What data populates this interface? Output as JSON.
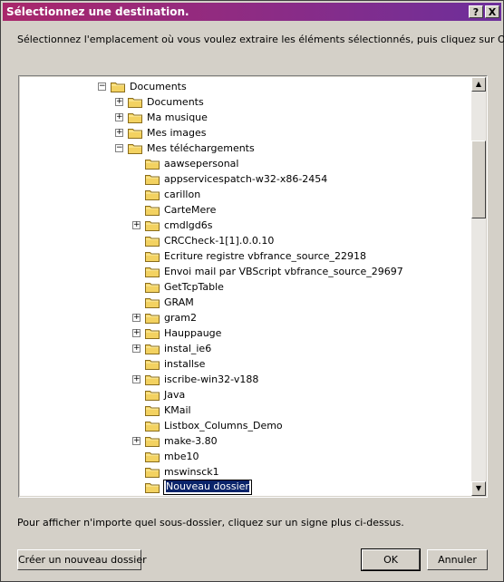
{
  "window": {
    "title": "Sélectionnez une destination.",
    "help_label": "?",
    "close_label": "X"
  },
  "instruction": "Sélectionnez l'emplacement où vous voulez extraire les éléments sélectionnés, puis cliquez sur OK.",
  "tree": {
    "items": [
      {
        "label": "Documents",
        "level": 0,
        "expander": "minus"
      },
      {
        "label": "Documents",
        "level": 1,
        "expander": "plus"
      },
      {
        "label": "Ma musique",
        "level": 1,
        "expander": "plus"
      },
      {
        "label": "Mes images",
        "level": 1,
        "expander": "plus"
      },
      {
        "label": "Mes téléchargements",
        "level": 1,
        "expander": "minus"
      },
      {
        "label": "aawsepersonal",
        "level": 2,
        "expander": "none"
      },
      {
        "label": "appservicespatch-w32-x86-2454",
        "level": 2,
        "expander": "none"
      },
      {
        "label": "carillon",
        "level": 2,
        "expander": "none"
      },
      {
        "label": "CarteMere",
        "level": 2,
        "expander": "none"
      },
      {
        "label": "cmdlgd6s",
        "level": 2,
        "expander": "plus"
      },
      {
        "label": "CRCCheck-1[1].0.0.10",
        "level": 2,
        "expander": "none"
      },
      {
        "label": "Ecriture registre vbfrance_source_22918",
        "level": 2,
        "expander": "none"
      },
      {
        "label": "Envoi mail par VBScript vbfrance_source_29697",
        "level": 2,
        "expander": "none"
      },
      {
        "label": "GetTcpTable",
        "level": 2,
        "expander": "none"
      },
      {
        "label": "GRAM",
        "level": 2,
        "expander": "none"
      },
      {
        "label": "gram2",
        "level": 2,
        "expander": "plus"
      },
      {
        "label": "Hauppauge",
        "level": 2,
        "expander": "plus"
      },
      {
        "label": "instal_ie6",
        "level": 2,
        "expander": "plus"
      },
      {
        "label": "installse",
        "level": 2,
        "expander": "none"
      },
      {
        "label": "iscribe-win32-v188",
        "level": 2,
        "expander": "plus"
      },
      {
        "label": "Java",
        "level": 2,
        "expander": "none"
      },
      {
        "label": "KMail",
        "level": 2,
        "expander": "none"
      },
      {
        "label": "Listbox_Columns_Demo",
        "level": 2,
        "expander": "none"
      },
      {
        "label": "make-3.80",
        "level": 2,
        "expander": "plus"
      },
      {
        "label": "mbe10",
        "level": 2,
        "expander": "none"
      },
      {
        "label": "mswinsck1",
        "level": 2,
        "expander": "none"
      },
      {
        "label": "Nouveau dossier",
        "level": 2,
        "expander": "none",
        "editing": true
      }
    ]
  },
  "hint": "Pour afficher n'importe quel sous-dossier, cliquez sur un signe plus ci-dessus.",
  "buttons": {
    "new_folder": "Créer un nouveau dossier",
    "ok": "OK",
    "cancel": "Annuler"
  },
  "colors": {
    "title_gradient_start": "#a9276b",
    "title_gradient_end": "#6d2f9b",
    "folder_yellow": "#f3d261",
    "selection": "#0a246a"
  }
}
